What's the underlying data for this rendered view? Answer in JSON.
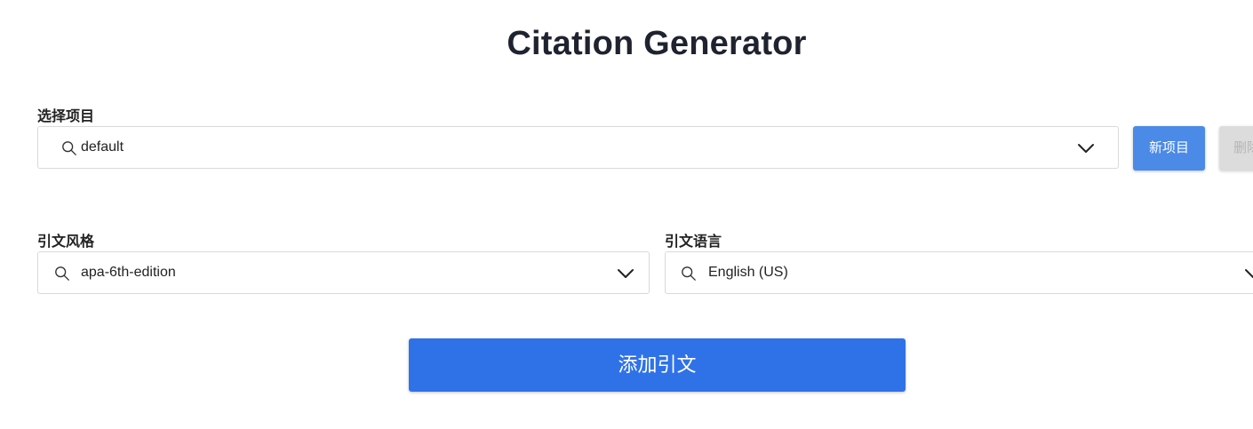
{
  "header": {
    "title": "Citation Generator"
  },
  "project": {
    "label": "选择项目",
    "value": "default",
    "new_button": "新项目",
    "delete_button": "删除"
  },
  "style": {
    "label": "引文风格",
    "value": "apa-6th-edition"
  },
  "language": {
    "label": "引文语言",
    "value": "English (US)"
  },
  "actions": {
    "add_citation": "添加引文"
  },
  "colors": {
    "primary": "#4b8ae6",
    "primary_big": "#2f72e8",
    "disabled": "#dcdcdc",
    "text": "#1f2330"
  }
}
